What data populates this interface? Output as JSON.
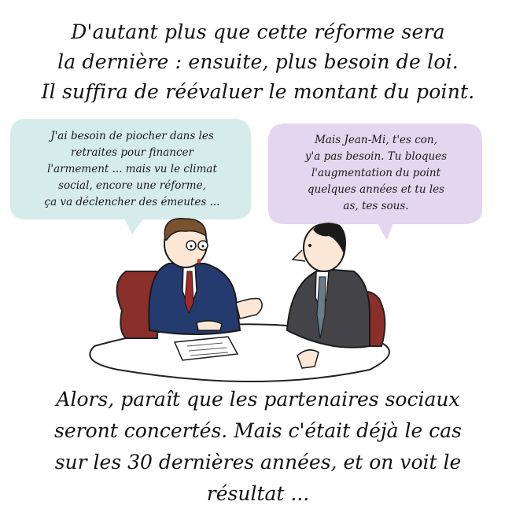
{
  "top_caption": {
    "line1": "D'autant plus que cette réforme sera",
    "line2": "la dernière : ensuite, plus besoin de loi.",
    "line3": "Il suffira de réévaluer le montant du point."
  },
  "left_bubble": {
    "line1": "J'ai besoin de piocher dans les",
    "line2": "retraites pour financer",
    "line3": "l'armement ... mais vu le climat",
    "line4": "social, encore une réforme,",
    "line5": "ça va déclencher des émeutes ...",
    "color": "#d6ecea"
  },
  "right_bubble": {
    "line1": "Mais Jean-Mi, t'es con,",
    "line2": "y'a pas besoin. Tu bloques",
    "line3": "l'augmentation du point",
    "line4": "quelques années et tu les",
    "line5": "as, tes sous.",
    "color": "#e3d6ee"
  },
  "bottom_caption": {
    "line1": "Alors, paraît que les partenaires sociaux",
    "line2": "seront concertés. Mais c'était déjà le cas",
    "line3": "sur les 30 dernières années, et on voit le",
    "line4": "résultat ..."
  }
}
